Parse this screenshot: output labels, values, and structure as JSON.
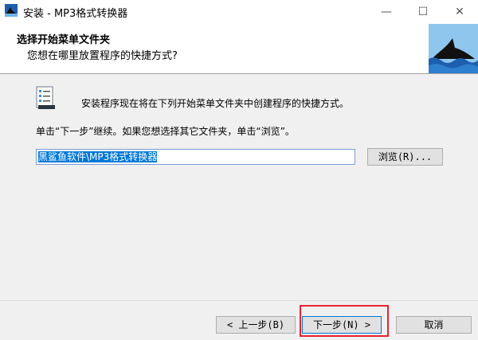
{
  "window": {
    "title": "安装 - MP3格式转换器"
  },
  "header": {
    "title": "选择开始菜单文件夹",
    "subtitle": "您想在哪里放置程序的快捷方式?"
  },
  "content": {
    "intro_text": "安装程序现在将在下列开始菜单文件夹中创建程序的快捷方式。",
    "instruction_text": "单击“下一步”继续。如果您想选择其它文件夹，单击“浏览”。",
    "folder_value": "黑鲨鱼软件\\MP3格式转换器",
    "browse_label": "浏览(R)..."
  },
  "footer": {
    "back_label": "< 上一步(B)",
    "next_label": "下一步(N) >",
    "cancel_label": "取消"
  },
  "colors": {
    "highlight": "#e8232c",
    "selection": "#0078d7",
    "panel": "#f0f0f0"
  }
}
